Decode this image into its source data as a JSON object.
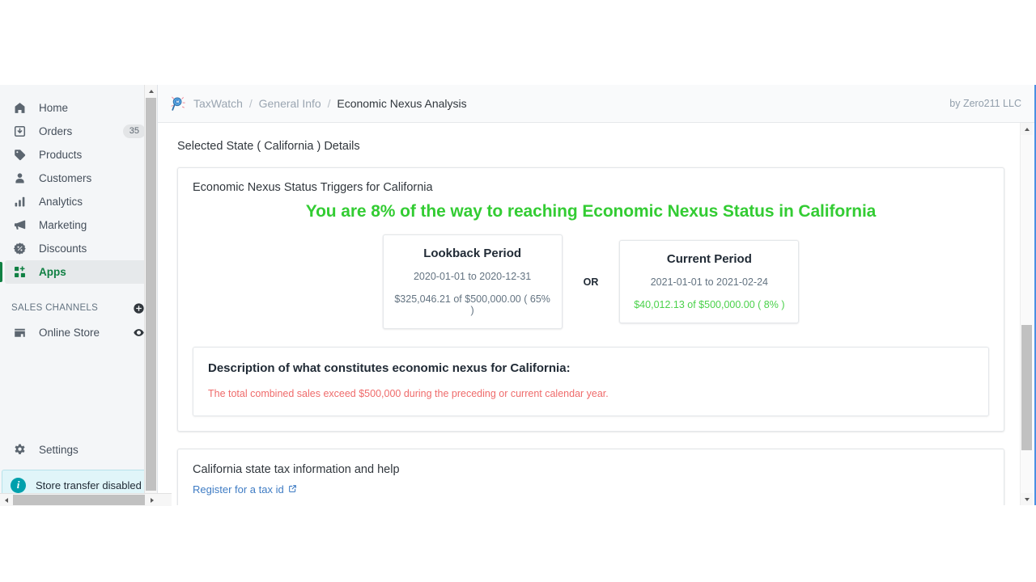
{
  "sidebar": {
    "nav": [
      {
        "label": "Home",
        "icon": "home-icon",
        "badge": ""
      },
      {
        "label": "Orders",
        "icon": "orders-inbox-icon",
        "badge": "35"
      },
      {
        "label": "Products",
        "icon": "tag-icon",
        "badge": ""
      },
      {
        "label": "Customers",
        "icon": "person-icon",
        "badge": ""
      },
      {
        "label": "Analytics",
        "icon": "bar-chart-icon",
        "badge": ""
      },
      {
        "label": "Marketing",
        "icon": "megaphone-icon",
        "badge": ""
      },
      {
        "label": "Discounts",
        "icon": "discount-badge-icon",
        "badge": ""
      },
      {
        "label": "Apps",
        "icon": "apps-grid-plus-icon",
        "badge": ""
      }
    ],
    "active_item": "Apps",
    "sales_channels": {
      "title": "SALES CHANNELS",
      "add_icon": "plus-circle-icon",
      "items": [
        {
          "label": "Online Store",
          "icon": "storefront-icon",
          "action_icon": "eye-icon"
        }
      ]
    },
    "settings": {
      "label": "Settings",
      "icon": "gear-icon"
    },
    "store_transfer": {
      "label": "Store transfer disabled",
      "icon": "info-circle-icon"
    }
  },
  "topbar": {
    "logo_icon": "magnifier-app-logo-icon",
    "breadcrumb": {
      "app": "TaxWatch",
      "section": "General Info",
      "page": "Economic Nexus Analysis",
      "separator": "/"
    },
    "attribution": "by Zero211 LLC"
  },
  "main": {
    "page_title": "Selected State ( California ) Details",
    "trigger_card": {
      "title": "Economic Nexus Status Triggers for California",
      "headline": "You are 8% of the way to reaching Economic Nexus Status in California",
      "headline_color": "#33cc33",
      "separator_label": "OR",
      "periods": [
        {
          "title": "Lookback Period",
          "dates": "2020-01-01 to 2020-12-31",
          "amount": "$325,046.21 of $500,000.00 ( 65% )",
          "highlight": false
        },
        {
          "title": "Current Period",
          "dates": "2021-01-01 to 2021-02-24",
          "amount": "$40,012.13 of $500,000.00 ( 8% )",
          "highlight": true
        }
      ],
      "description": {
        "title": "Description of what constitutes economic nexus for California:",
        "text": "The total combined sales exceed $500,000 during the preceding or current calendar year.",
        "text_color": "#ef6b6b"
      }
    },
    "tax_info_card": {
      "title": "California state tax information and help",
      "link_label": "Register for a tax id",
      "link_icon": "external-link-icon"
    }
  },
  "scrollbars": {
    "sidebar_vertical": {
      "up_icon": "caret-up-icon",
      "down_icon": "caret-down-icon"
    },
    "main_vertical": {
      "up_icon": "caret-up-icon",
      "down_icon": "caret-down-icon"
    },
    "horizontal": {
      "left_icon": "caret-left-icon",
      "right_icon": "caret-right-icon"
    }
  }
}
